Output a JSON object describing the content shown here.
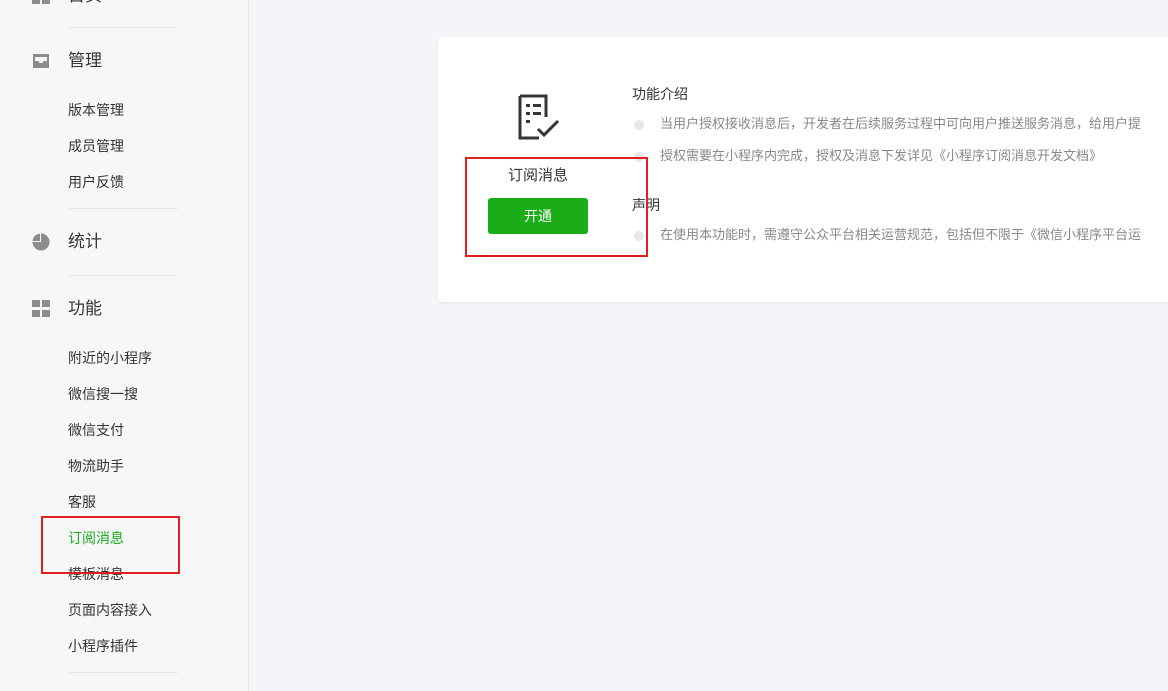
{
  "sidebar": {
    "top_partial_label": "首页",
    "categories": [
      {
        "label": "管理",
        "icon": "inbox-icon"
      },
      {
        "label": "统计",
        "icon": "pie-chart-icon"
      },
      {
        "label": "功能",
        "icon": "grid-icon"
      }
    ],
    "manage_items": [
      "版本管理",
      "成员管理",
      "用户反馈"
    ],
    "feature_items": [
      "附近的小程序",
      "微信搜一搜",
      "微信支付",
      "物流助手",
      "客服",
      "订阅消息",
      "模板消息",
      "页面内容接入",
      "小程序插件"
    ],
    "active_item": "订阅消息"
  },
  "card": {
    "icon": "document-check-icon",
    "title": "订阅消息",
    "button_label": "开通",
    "intro_title": "功能介绍",
    "intro_items": [
      "当用户授权接收消息后，开发者在后续服务过程中可向用户推送服务消息，给用户提",
      "授权需要在小程序内完成，授权及消息下发详见《小程序订阅消息开发文档》"
    ],
    "statement_title": "声明",
    "statement_items": [
      "在使用本功能时，需遵守公众平台相关运营规范，包括但不限于《微信小程序平台运"
    ]
  },
  "colors": {
    "accent": "#1aad19",
    "annotation": "#e02020",
    "bullet": "#e7e7eb"
  }
}
